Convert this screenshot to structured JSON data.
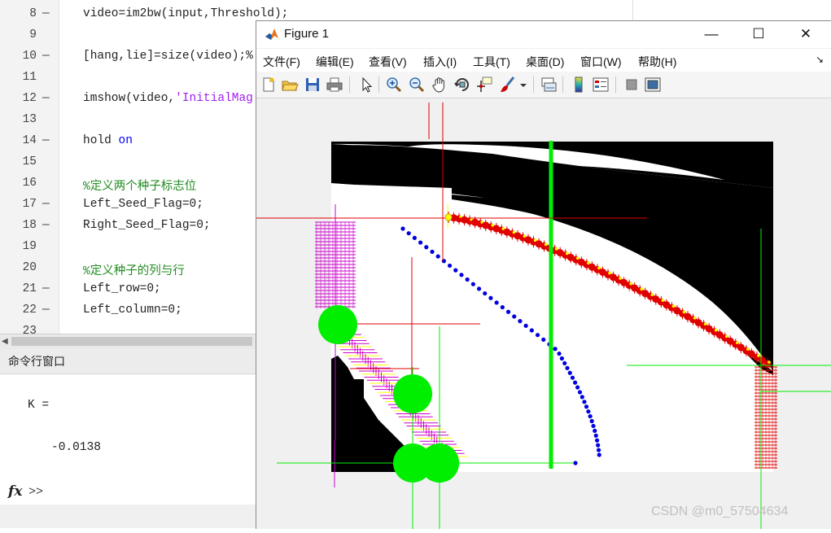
{
  "editor": {
    "lines": [
      {
        "n": "8",
        "dash": "—",
        "parts": [
          [
            "video=im2bw(input,Threshold);",
            ""
          ]
        ]
      },
      {
        "n": "9",
        "dash": "",
        "parts": []
      },
      {
        "n": "10",
        "dash": "—",
        "parts": [
          [
            "[hang,lie]=size(video);",
            ""
          ],
          [
            "%",
            ""
          ]
        ]
      },
      {
        "n": "11",
        "dash": "",
        "parts": []
      },
      {
        "n": "12",
        "dash": "—",
        "parts": [
          [
            "imshow(video,",
            ""
          ],
          [
            "'InitialMag",
            "str"
          ]
        ]
      },
      {
        "n": "13",
        "dash": "",
        "parts": []
      },
      {
        "n": "14",
        "dash": "—",
        "parts": [
          [
            "hold ",
            ""
          ],
          [
            "on",
            "kw"
          ]
        ]
      },
      {
        "n": "15",
        "dash": "",
        "parts": []
      },
      {
        "n": "16",
        "dash": "",
        "parts": [
          [
            "%定义两个种子标志位",
            "cm"
          ]
        ]
      },
      {
        "n": "17",
        "dash": "—",
        "parts": [
          [
            "Left_Seed_Flag=0;",
            ""
          ]
        ]
      },
      {
        "n": "18",
        "dash": "—",
        "parts": [
          [
            "Right_Seed_Flag=0;",
            ""
          ]
        ]
      },
      {
        "n": "19",
        "dash": "",
        "parts": []
      },
      {
        "n": "20",
        "dash": "",
        "parts": [
          [
            "%定义种子的列与行",
            "cm"
          ]
        ]
      },
      {
        "n": "21",
        "dash": "—",
        "parts": [
          [
            "Left_row=0;",
            ""
          ]
        ]
      },
      {
        "n": "22",
        "dash": "—",
        "parts": [
          [
            "Left_column=0;",
            ""
          ]
        ]
      },
      {
        "n": "23",
        "dash": "",
        "parts": []
      }
    ]
  },
  "command_window": {
    "title": "命令行窗口",
    "output_line1": "K =",
    "output_line2": "-0.0138",
    "prompt": ">>"
  },
  "figure": {
    "title": "Figure 1",
    "window_buttons": {
      "minimize": "—",
      "maximize": "☐",
      "close": "✕"
    },
    "menus": [
      "文件(F)",
      "编辑(E)",
      "查看(V)",
      "插入(I)",
      "工具(T)",
      "桌面(D)",
      "窗口(W)",
      "帮助(H)"
    ],
    "toolbar_icons": [
      "new-figure-icon",
      "open-file-icon",
      "save-icon",
      "print-icon",
      "pointer-icon",
      "zoom-in-icon",
      "zoom-out-icon",
      "pan-icon",
      "rotate-3d-icon",
      "data-cursor-icon",
      "brush-icon",
      "brush-dropdown-icon",
      "link-plot-icon",
      "colorbar-icon",
      "legend-icon",
      "hide-plot-tools-icon",
      "show-plot-tools-icon"
    ]
  },
  "colors": {
    "red": "#e00000",
    "green": "#00ee00",
    "blue": "#0000e0",
    "magenta": "#cc00cc",
    "yellow": "#ffff00"
  },
  "watermark": "CSDN @m0_57504634"
}
